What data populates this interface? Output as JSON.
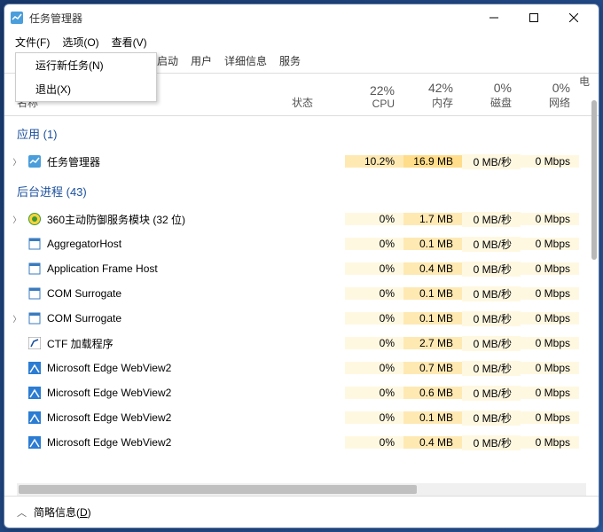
{
  "window": {
    "title": "任务管理器"
  },
  "menubar": {
    "file": "文件(F)",
    "options": "选项(O)",
    "view": "查看(V)"
  },
  "dropdown": {
    "runNewTask": "运行新任务(N)",
    "exit": "退出(X)"
  },
  "tabs": {
    "startup": "启动",
    "users": "用户",
    "details": "详细信息",
    "services": "服务"
  },
  "columns": {
    "name": "名称",
    "status": "状态",
    "cpu": "CPU",
    "mem": "内存",
    "disk": "磁盘",
    "net": "网络",
    "power": "电"
  },
  "totals": {
    "cpu": "22%",
    "mem": "42%",
    "disk": "0%",
    "net": "0%"
  },
  "groups": {
    "apps": "应用 (1)",
    "bg": "后台进程 (43)"
  },
  "rows": [
    {
      "name": "任务管理器",
      "cpu": "10.2%",
      "mem": "16.9 MB",
      "disk": "0 MB/秒",
      "net": "0 Mbps",
      "icon": "taskmgr",
      "expand": true,
      "hlcpu": true,
      "hlmem": true
    },
    {
      "name": "360主动防御服务模块 (32 位)",
      "cpu": "0%",
      "mem": "1.7 MB",
      "disk": "0 MB/秒",
      "net": "0 Mbps",
      "icon": "360",
      "expand": true
    },
    {
      "name": "AggregatorHost",
      "cpu": "0%",
      "mem": "0.1 MB",
      "disk": "0 MB/秒",
      "net": "0 Mbps",
      "icon": "generic"
    },
    {
      "name": "Application Frame Host",
      "cpu": "0%",
      "mem": "0.4 MB",
      "disk": "0 MB/秒",
      "net": "0 Mbps",
      "icon": "generic"
    },
    {
      "name": "COM Surrogate",
      "cpu": "0%",
      "mem": "0.1 MB",
      "disk": "0 MB/秒",
      "net": "0 Mbps",
      "icon": "generic"
    },
    {
      "name": "COM Surrogate",
      "cpu": "0%",
      "mem": "0.1 MB",
      "disk": "0 MB/秒",
      "net": "0 Mbps",
      "icon": "generic",
      "expand": true
    },
    {
      "name": "CTF 加载程序",
      "cpu": "0%",
      "mem": "2.7 MB",
      "disk": "0 MB/秒",
      "net": "0 Mbps",
      "icon": "ctf"
    },
    {
      "name": "Microsoft Edge WebView2",
      "cpu": "0%",
      "mem": "0.7 MB",
      "disk": "0 MB/秒",
      "net": "0 Mbps",
      "icon": "edge"
    },
    {
      "name": "Microsoft Edge WebView2",
      "cpu": "0%",
      "mem": "0.6 MB",
      "disk": "0 MB/秒",
      "net": "0 Mbps",
      "icon": "edge"
    },
    {
      "name": "Microsoft Edge WebView2",
      "cpu": "0%",
      "mem": "0.1 MB",
      "disk": "0 MB/秒",
      "net": "0 Mbps",
      "icon": "edge"
    },
    {
      "name": "Microsoft Edge WebView2",
      "cpu": "0%",
      "mem": "0.4 MB",
      "disk": "0 MB/秒",
      "net": "0 Mbps",
      "icon": "edge"
    }
  ],
  "footer": {
    "details": "简略信息(D)"
  }
}
